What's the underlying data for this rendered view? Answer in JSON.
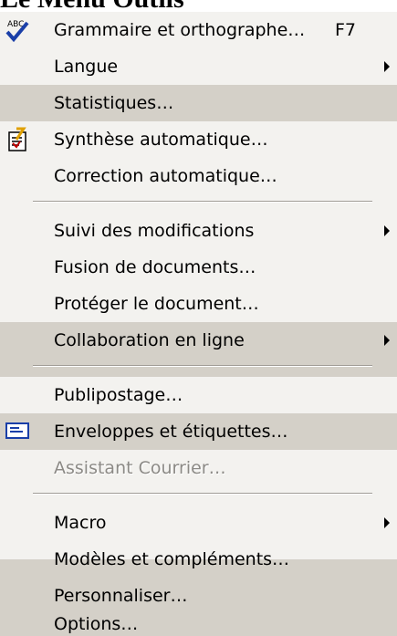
{
  "page": {
    "title": "Le Menu Outils"
  },
  "menu": {
    "items": [
      {
        "label": "Grammaire et orthographe…",
        "shortcut": "F7",
        "icon": "spellcheck-abc-icon"
      },
      {
        "label": "Langue",
        "submenu": true
      },
      {
        "label": "Statistiques…"
      },
      {
        "label": "Synthèse automatique…",
        "icon": "autosummarize-icon"
      },
      {
        "label": "Correction automatique…"
      },
      {
        "label": "Suivi des modifications",
        "submenu": true
      },
      {
        "label": "Fusion de documents…"
      },
      {
        "label": "Protéger le document…"
      },
      {
        "label": "Collaboration en ligne",
        "submenu": true
      },
      {
        "label": "Publipostage…"
      },
      {
        "label": "Enveloppes et étiquettes…",
        "icon": "envelope-labels-icon"
      },
      {
        "label": "Assistant Courrier…",
        "disabled": true
      },
      {
        "label": "Macro",
        "submenu": true
      },
      {
        "label": "Modèles et compléments…"
      },
      {
        "label": "Personnaliser…"
      },
      {
        "label": "Options…"
      }
    ]
  },
  "colors": {
    "menu_bg": "#d4d0c8",
    "menu_light": "#f3f2ef",
    "disabled_text": "#8c8a86"
  }
}
